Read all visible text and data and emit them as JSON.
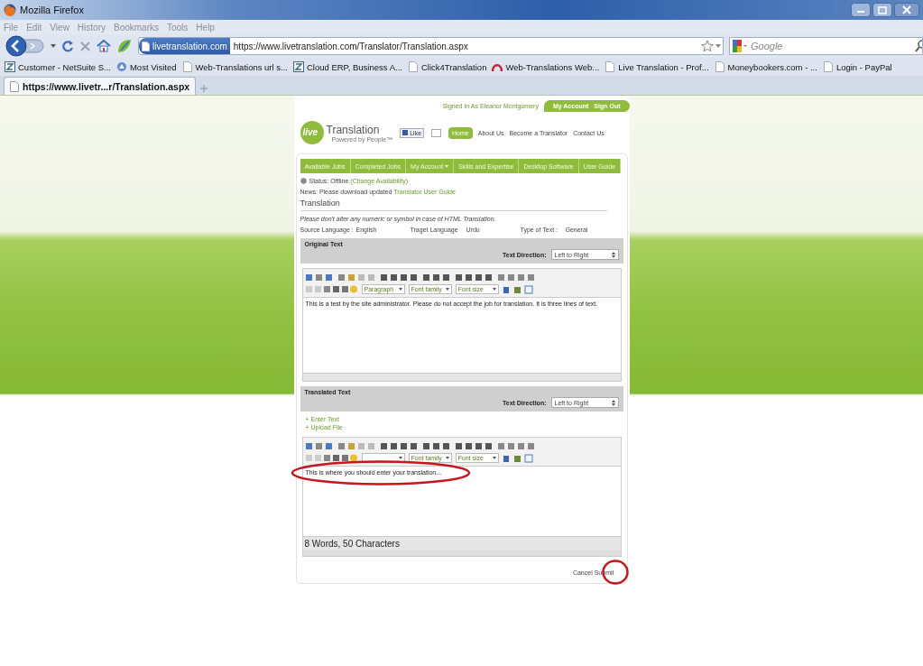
{
  "window": {
    "title": "Mozilla Firefox"
  },
  "menu": [
    "File",
    "Edit",
    "View",
    "History",
    "Bookmarks",
    "Tools",
    "Help"
  ],
  "address": {
    "site_label": "livetranslation.com",
    "url": "https://www.livetranslation.com/Translator/Translation.aspx"
  },
  "search": {
    "placeholder": "Google"
  },
  "bookmarks": [
    {
      "label": "Customer - NetSuite S...",
      "kind": "netsuite"
    },
    {
      "label": "Most Visited",
      "kind": "folder"
    },
    {
      "label": "Web-Translations url s...",
      "kind": "page"
    },
    {
      "label": "Cloud ERP, Business A...",
      "kind": "netsuite"
    },
    {
      "label": "Click4Translation",
      "kind": "page"
    },
    {
      "label": "Web-Translations Web...",
      "kind": "arc"
    },
    {
      "label": "Live Translation - Prof...",
      "kind": "page"
    },
    {
      "label": "Moneybookers.com - ...",
      "kind": "page"
    },
    {
      "label": "Login - PayPal",
      "kind": "page"
    }
  ],
  "tabs": [
    {
      "label": "https://www.livetr...r/Translation.aspx",
      "selected": true
    }
  ],
  "site": {
    "signed_in": "Signed In As Eleanor Montgomery",
    "account_links": [
      "My Account",
      "Sign Out"
    ],
    "logo": {
      "mark": "live",
      "name": "Translation",
      "tagline": "Powered by People™"
    },
    "like": "Like",
    "nav": [
      {
        "label": "Home",
        "selected": true
      },
      {
        "label": "About Us",
        "selected": false
      },
      {
        "label": "Become a Translator",
        "selected": false
      },
      {
        "label": "Contact Us",
        "selected": false
      }
    ],
    "menu": [
      {
        "label": "Available Jobs",
        "dropdown": false
      },
      {
        "label": "Completed Jobs",
        "dropdown": false
      },
      {
        "label": "My Account",
        "dropdown": true
      },
      {
        "label": "Skills and Expertise",
        "dropdown": false
      },
      {
        "label": "Desktop Software",
        "dropdown": false
      },
      {
        "label": "User Guide",
        "dropdown": false
      }
    ],
    "status": {
      "text": "Status: Offline",
      "link": "(Change Availability)"
    },
    "news": {
      "text": "News: Please download updated",
      "link": "Translator User Guide"
    },
    "heading": "Translation",
    "note": "Please don't alter any numeric or symbol in case of HTML Translation.",
    "info": [
      {
        "label": "Source Language :",
        "value": "English"
      },
      {
        "label": "Traget Language",
        "value": "Urdu"
      },
      {
        "label": "Type of Text :",
        "value": "General"
      }
    ],
    "panels": [
      {
        "title": "Original Text",
        "direction_label": "Text Direction:",
        "direction": "Left to Right",
        "block_format": "Paragraph",
        "font_family": "Font family",
        "font_size": "Font size",
        "circled": false,
        "text": "This is a test by the site administrator. Please do not accept the job for translation. It is three lines of text."
      },
      {
        "title": "Translated Text",
        "direction_label": "Text Direction:",
        "direction": "Left to Right",
        "options": [
          "+ Enter Text",
          "+ Upload File"
        ],
        "font_family": "Font family",
        "font_size": "Font size",
        "circled": true,
        "text": "This is where you should enter your translation...",
        "count": "8 Words, 50 Characters"
      }
    ],
    "buttons": [
      {
        "label": "Cancel",
        "circled": false
      },
      {
        "label": "Submit",
        "circled": true
      }
    ]
  }
}
